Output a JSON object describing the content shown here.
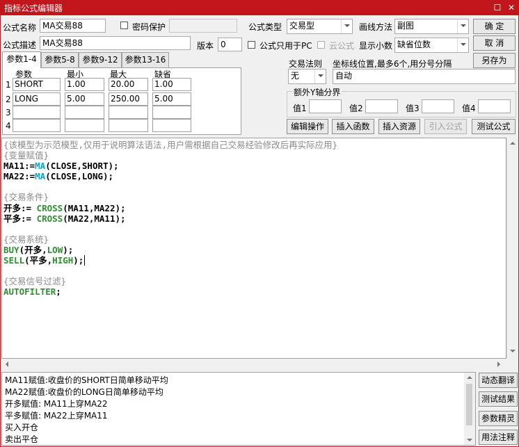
{
  "window": {
    "title": "指标公式编辑器",
    "restore_glyph": "☐",
    "close_glyph": "✕"
  },
  "form": {
    "name_label": "公式名称",
    "name_value": "MA交易88",
    "password_label": "密码保护",
    "type_label": "公式类型",
    "type_value": "交易型",
    "draw_label": "画线方法",
    "draw_value": "副图",
    "desc_label": "公式描述",
    "desc_value": "MA交易88",
    "version_label": "版本",
    "version_value": "0",
    "pc_only_label": "公式只用于PC",
    "cloud_label": "云公式",
    "decimals_label": "显示小数",
    "decimals_value": "缺省位数"
  },
  "buttons": {
    "ok": "确  定",
    "cancel": "取  消",
    "save_as": "另存为",
    "edit_op": "编辑操作",
    "insert_func": "插入函数",
    "insert_res": "插入资源",
    "import_formula": "引入公式",
    "test_formula": "测试公式"
  },
  "tabs": [
    "参数1-4",
    "参数5-8",
    "参数9-12",
    "参数13-16"
  ],
  "params": {
    "headers": [
      "参数",
      "最小",
      "最大",
      "缺省"
    ],
    "rows": [
      {
        "idx": "1",
        "name": "SHORT",
        "min": "1.00",
        "max": "20.00",
        "def": "1.00"
      },
      {
        "idx": "2",
        "name": "LONG",
        "min": "5.00",
        "max": "250.00",
        "def": "5.00"
      },
      {
        "idx": "3",
        "name": "",
        "min": "",
        "max": "",
        "def": ""
      },
      {
        "idx": "4",
        "name": "",
        "min": "",
        "max": "",
        "def": ""
      }
    ]
  },
  "trade_rule": {
    "label": "交易法则",
    "value": "无"
  },
  "axis_pos": {
    "label": "坐标线位置,最多6个,用分号分隔",
    "value": "自动"
  },
  "extra_axis": {
    "label": "额外Y轴分界",
    "fields": [
      {
        "label": "值1",
        "value": ""
      },
      {
        "label": "值2",
        "value": ""
      },
      {
        "label": "值3",
        "value": ""
      },
      {
        "label": "值4",
        "value": ""
      }
    ]
  },
  "code": {
    "l1": "{该模型为示范模型,仅用于说明算法语法,用户需根据自己交易经验修改后再实际应用}",
    "l2": "{变量赋值}",
    "l3a": "MA11:=",
    "l3b": "MA",
    "l3c": "(CLOSE,SHORT);",
    "l4a": "MA22:=",
    "l4b": "MA",
    "l4c": "(CLOSE,LONG);",
    "l6": "{交易条件}",
    "l7a": "开多:= ",
    "l7b": "CROSS",
    "l7c": "(MA11,MA22);",
    "l8a": "平多:= ",
    "l8b": "CROSS",
    "l8c": "(MA22,MA11);",
    "l10": "{交易系统}",
    "l11a": "BUY",
    "l11b": "(开多,",
    "l11c": "LOW",
    "l11d": ");",
    "l12a": "SELL",
    "l12b": "(平多,",
    "l12c": "HIGH",
    "l12d": ");",
    "l14": "{交易信号过滤}",
    "l15a": "AUTOFILTER",
    "l15b": ";"
  },
  "explain": [
    "MA11赋值:收盘价的SHORT日简单移动平均",
    "MA22赋值:收盘价的LONG日简单移动平均",
    "开多赋值: MA11上穿MA22",
    "平多赋值: MA22上穿MA11",
    "买入开仓",
    "卖出平仓"
  ],
  "side_buttons": [
    "动态翻译",
    "测试结果",
    "参数精灵",
    "用法注释"
  ]
}
